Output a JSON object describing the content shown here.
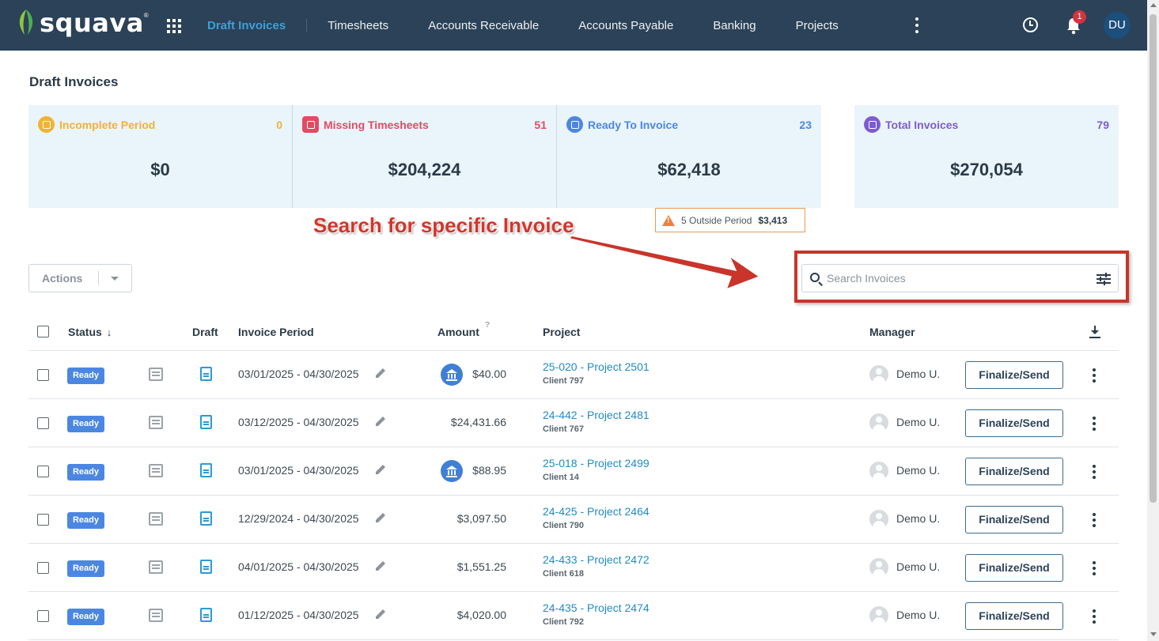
{
  "app": {
    "brand": "squava",
    "nav": [
      "Draft Invoices",
      "Timesheets",
      "Accounts Receivable",
      "Accounts Payable",
      "Banking",
      "Projects"
    ],
    "notification_count": "1",
    "user_initials": "DU"
  },
  "page": {
    "title": "Draft Invoices"
  },
  "cards": [
    {
      "label": "Incomplete Period",
      "count": "0",
      "amount": "$0",
      "color": "#f2b232"
    },
    {
      "label": "Missing Timesheets",
      "count": "51",
      "amount": "$204,224",
      "color": "#e34b63"
    },
    {
      "label": "Ready To Invoice",
      "count": "23",
      "amount": "$62,418",
      "color": "#4b87e2"
    },
    {
      "label": "Total Invoices",
      "count": "79",
      "amount": "$270,054",
      "color": "#7d5ccf"
    }
  ],
  "outside_period": {
    "count": "5",
    "label": "Outside Period",
    "amount": "$3,413"
  },
  "annotation": {
    "text": "Search for specific Invoice"
  },
  "toolbar": {
    "actions_label": "Actions",
    "search_placeholder": "Search Invoices"
  },
  "table": {
    "headers": {
      "status": "Status",
      "draft": "Draft",
      "period": "Invoice Period",
      "amount": "Amount",
      "amount_help": "?",
      "project": "Project",
      "manager": "Manager"
    },
    "rows": [
      {
        "status": "Ready",
        "period": "03/01/2025 - 04/30/2025",
        "amount": "$40.00",
        "bank": true,
        "project": "25-020 - Project 2501",
        "client": "Client 797",
        "manager": "Demo U.",
        "action": "Finalize/Send"
      },
      {
        "status": "Ready",
        "period": "03/12/2025 - 04/30/2025",
        "amount": "$24,431.66",
        "bank": false,
        "project": "24-442 - Project 2481",
        "client": "Client 767",
        "manager": "Demo U.",
        "action": "Finalize/Send"
      },
      {
        "status": "Ready",
        "period": "03/01/2025 - 04/30/2025",
        "amount": "$88.95",
        "bank": true,
        "project": "25-018 - Project 2499",
        "client": "Client 14",
        "manager": "Demo U.",
        "action": "Finalize/Send"
      },
      {
        "status": "Ready",
        "period": "12/29/2024 - 04/30/2025",
        "amount": "$3,097.50",
        "bank": false,
        "project": "24-425 - Project 2464",
        "client": "Client 790",
        "manager": "Demo U.",
        "action": "Finalize/Send"
      },
      {
        "status": "Ready",
        "period": "04/01/2025 - 04/30/2025",
        "amount": "$1,551.25",
        "bank": false,
        "project": "24-433 - Project 2472",
        "client": "Client 618",
        "manager": "Demo U.",
        "action": "Finalize/Send"
      },
      {
        "status": "Ready",
        "period": "01/12/2025 - 04/30/2025",
        "amount": "$4,020.00",
        "bank": false,
        "project": "24-435 - Project 2474",
        "client": "Client 792",
        "manager": "Demo U.",
        "action": "Finalize/Send"
      }
    ]
  }
}
